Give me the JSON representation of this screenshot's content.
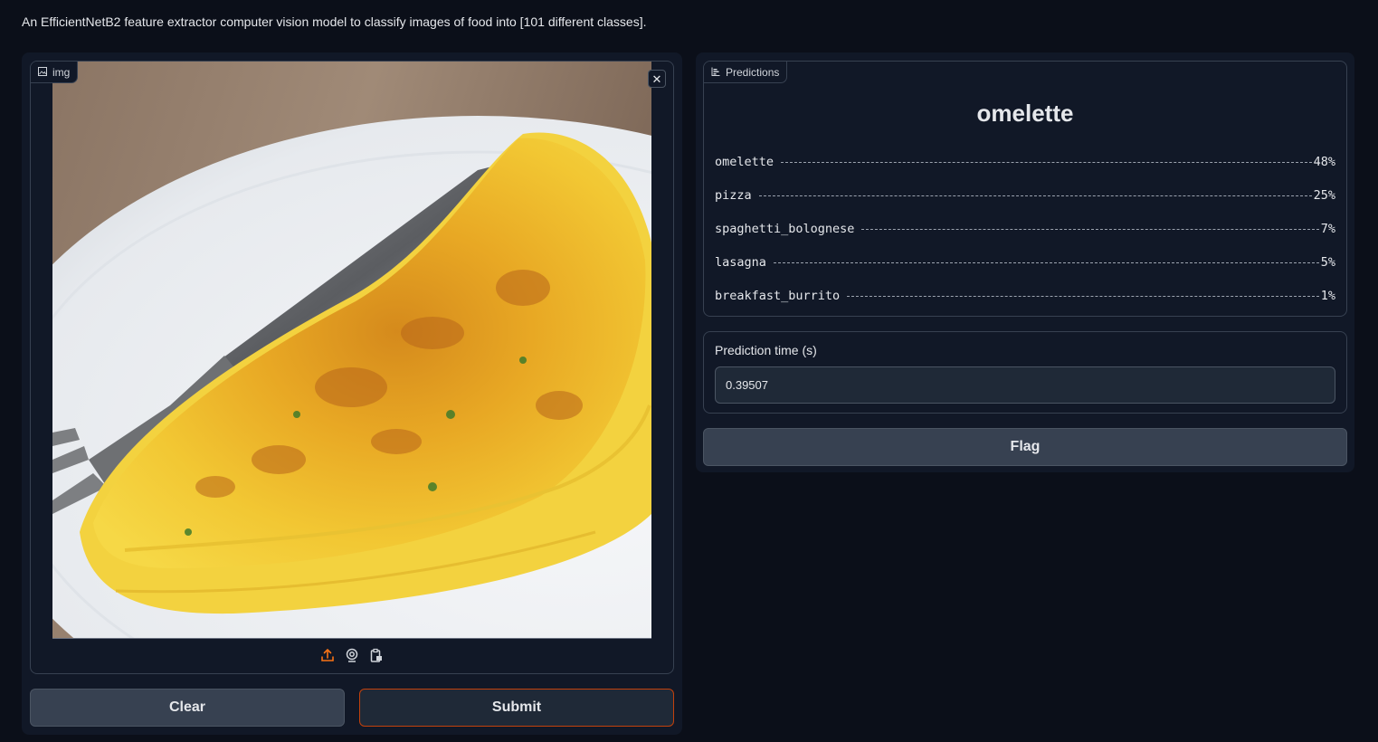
{
  "description": "An EfficientNetB2 feature extractor computer vision model to classify images of food into [101 different classes].",
  "input": {
    "label": "img",
    "label_icon": "image-icon",
    "close_icon": "close-icon",
    "toolbar_icons": [
      "upload-icon",
      "webcam-icon",
      "clipboard-icon"
    ]
  },
  "buttons": {
    "clear": "Clear",
    "submit": "Submit",
    "flag": "Flag"
  },
  "predictions": {
    "label": "Predictions",
    "label_icon": "bar-chart-icon",
    "top_label": "omelette",
    "confidences": [
      {
        "name": "omelette",
        "value": "48%"
      },
      {
        "name": "pizza",
        "value": "25%"
      },
      {
        "name": "spaghetti_bolognese",
        "value": "7%"
      },
      {
        "name": "lasagna",
        "value": "5%"
      },
      {
        "name": "breakfast_burrito",
        "value": "1%"
      }
    ]
  },
  "prediction_time": {
    "label": "Prediction time (s)",
    "value": "0.39507"
  },
  "colors": {
    "background": "#0b0f19",
    "panel": "#111827",
    "border": "#374151",
    "accent": "#f97316",
    "submit_border": "#c2410c"
  }
}
